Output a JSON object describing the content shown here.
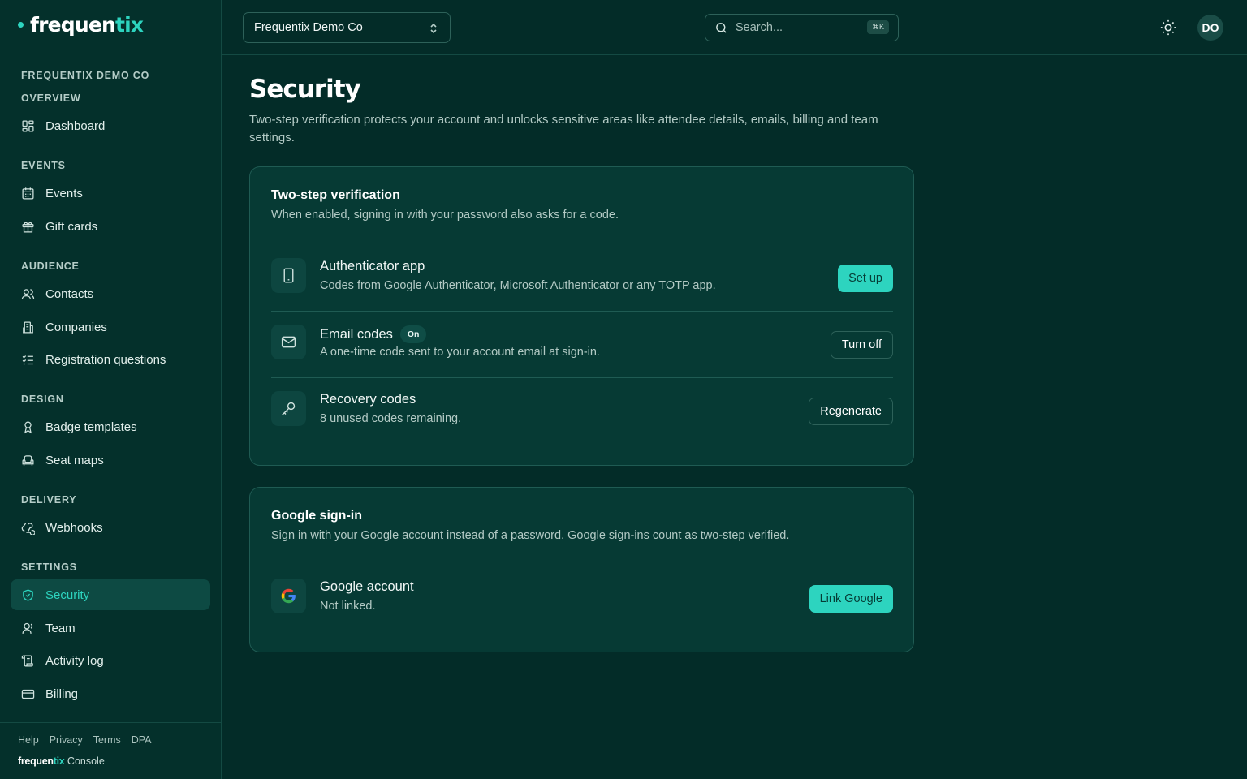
{
  "brand": {
    "name_a": "frequen",
    "name_b": "tix"
  },
  "sidebar": {
    "org_label": "FREQUENTIX DEMO CO",
    "sections": [
      {
        "label": "OVERVIEW",
        "items": [
          {
            "label": "Dashboard",
            "icon": "dashboard-icon"
          }
        ]
      },
      {
        "label": "EVENTS",
        "items": [
          {
            "label": "Events",
            "icon": "calendar-icon"
          },
          {
            "label": "Gift cards",
            "icon": "gift-icon"
          }
        ]
      },
      {
        "label": "AUDIENCE",
        "items": [
          {
            "label": "Contacts",
            "icon": "users-icon"
          },
          {
            "label": "Companies",
            "icon": "building-icon"
          },
          {
            "label": "Registration questions",
            "icon": "checklist-icon"
          }
        ]
      },
      {
        "label": "DESIGN",
        "items": [
          {
            "label": "Badge templates",
            "icon": "badge-icon"
          },
          {
            "label": "Seat maps",
            "icon": "seat-icon"
          }
        ]
      },
      {
        "label": "DELIVERY",
        "items": [
          {
            "label": "Webhooks",
            "icon": "webhook-icon"
          }
        ]
      },
      {
        "label": "SETTINGS",
        "items": [
          {
            "label": "Security",
            "icon": "shield-icon",
            "active": true
          },
          {
            "label": "Team",
            "icon": "user-icon"
          },
          {
            "label": "Activity log",
            "icon": "scroll-icon"
          },
          {
            "label": "Billing",
            "icon": "credit-card-icon"
          }
        ]
      }
    ],
    "footer": {
      "links": [
        "Help",
        "Privacy",
        "Terms",
        "DPA"
      ],
      "brand_a": "frequen",
      "brand_b": "tix",
      "brand_suffix": " Console"
    }
  },
  "topbar": {
    "org_select": "Frequentix Demo Co",
    "search_placeholder": "Search...",
    "search_shortcut": "⌘K",
    "avatar_initials": "DO"
  },
  "page": {
    "title": "Security",
    "subtitle": "Two-step verification protects your account and unlocks sensitive areas like attendee details, emails, billing and team settings."
  },
  "two_step": {
    "title": "Two-step verification",
    "subtitle": "When enabled, signing in with your password also asks for a code.",
    "rows": [
      {
        "title": "Authenticator app",
        "desc": "Codes from Google Authenticator, Microsoft Authenticator or any TOTP app.",
        "button": "Set up",
        "icon": "phone-icon"
      },
      {
        "title": "Email codes",
        "badge": "On",
        "desc": "A one-time code sent to your account email at sign-in.",
        "button": "Turn off",
        "icon": "mail-icon"
      },
      {
        "title": "Recovery codes",
        "desc": "8 unused codes remaining.",
        "button": "Regenerate",
        "icon": "key-icon"
      }
    ]
  },
  "google": {
    "title": "Google sign-in",
    "subtitle": "Sign in with your Google account instead of a password. Google sign-ins count as two-step verified.",
    "row": {
      "title": "Google account",
      "desc": "Not linked.",
      "button": "Link Google",
      "icon": "google-icon"
    }
  },
  "colors": {
    "accent": "#2dd4bf",
    "background": "#032c28",
    "card": "#063a34"
  }
}
